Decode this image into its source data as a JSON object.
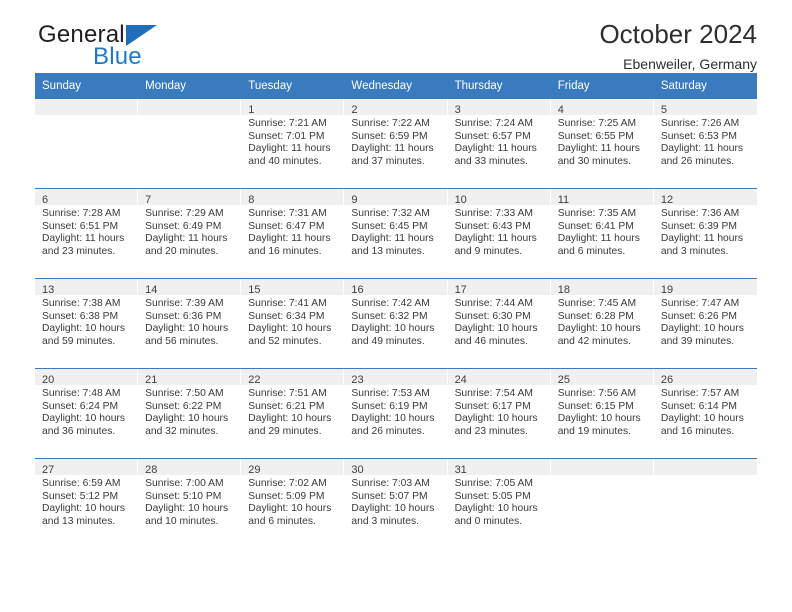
{
  "brand": {
    "name_top": "General",
    "name_bottom": "Blue",
    "triangle_color": "#1f6fba",
    "blue_color": "#1f7ac4"
  },
  "header": {
    "title": "October 2024",
    "subtitle": "Ebenweiler, Germany",
    "header_bg": "#3a7abf",
    "header_text": "#ffffff",
    "daystrip_bg": "#f0f0f0"
  },
  "weekdays": [
    "Sunday",
    "Monday",
    "Tuesday",
    "Wednesday",
    "Thursday",
    "Friday",
    "Saturday"
  ],
  "weeks": [
    [
      {
        "day": "",
        "sunrise": "",
        "sunset": "",
        "daylight": ""
      },
      {
        "day": "",
        "sunrise": "",
        "sunset": "",
        "daylight": ""
      },
      {
        "day": "1",
        "sunrise": "Sunrise: 7:21 AM",
        "sunset": "Sunset: 7:01 PM",
        "daylight": "Daylight: 11 hours and 40 minutes."
      },
      {
        "day": "2",
        "sunrise": "Sunrise: 7:22 AM",
        "sunset": "Sunset: 6:59 PM",
        "daylight": "Daylight: 11 hours and 37 minutes."
      },
      {
        "day": "3",
        "sunrise": "Sunrise: 7:24 AM",
        "sunset": "Sunset: 6:57 PM",
        "daylight": "Daylight: 11 hours and 33 minutes."
      },
      {
        "day": "4",
        "sunrise": "Sunrise: 7:25 AM",
        "sunset": "Sunset: 6:55 PM",
        "daylight": "Daylight: 11 hours and 30 minutes."
      },
      {
        "day": "5",
        "sunrise": "Sunrise: 7:26 AM",
        "sunset": "Sunset: 6:53 PM",
        "daylight": "Daylight: 11 hours and 26 minutes."
      }
    ],
    [
      {
        "day": "6",
        "sunrise": "Sunrise: 7:28 AM",
        "sunset": "Sunset: 6:51 PM",
        "daylight": "Daylight: 11 hours and 23 minutes."
      },
      {
        "day": "7",
        "sunrise": "Sunrise: 7:29 AM",
        "sunset": "Sunset: 6:49 PM",
        "daylight": "Daylight: 11 hours and 20 minutes."
      },
      {
        "day": "8",
        "sunrise": "Sunrise: 7:31 AM",
        "sunset": "Sunset: 6:47 PM",
        "daylight": "Daylight: 11 hours and 16 minutes."
      },
      {
        "day": "9",
        "sunrise": "Sunrise: 7:32 AM",
        "sunset": "Sunset: 6:45 PM",
        "daylight": "Daylight: 11 hours and 13 minutes."
      },
      {
        "day": "10",
        "sunrise": "Sunrise: 7:33 AM",
        "sunset": "Sunset: 6:43 PM",
        "daylight": "Daylight: 11 hours and 9 minutes."
      },
      {
        "day": "11",
        "sunrise": "Sunrise: 7:35 AM",
        "sunset": "Sunset: 6:41 PM",
        "daylight": "Daylight: 11 hours and 6 minutes."
      },
      {
        "day": "12",
        "sunrise": "Sunrise: 7:36 AM",
        "sunset": "Sunset: 6:39 PM",
        "daylight": "Daylight: 11 hours and 3 minutes."
      }
    ],
    [
      {
        "day": "13",
        "sunrise": "Sunrise: 7:38 AM",
        "sunset": "Sunset: 6:38 PM",
        "daylight": "Daylight: 10 hours and 59 minutes."
      },
      {
        "day": "14",
        "sunrise": "Sunrise: 7:39 AM",
        "sunset": "Sunset: 6:36 PM",
        "daylight": "Daylight: 10 hours and 56 minutes."
      },
      {
        "day": "15",
        "sunrise": "Sunrise: 7:41 AM",
        "sunset": "Sunset: 6:34 PM",
        "daylight": "Daylight: 10 hours and 52 minutes."
      },
      {
        "day": "16",
        "sunrise": "Sunrise: 7:42 AM",
        "sunset": "Sunset: 6:32 PM",
        "daylight": "Daylight: 10 hours and 49 minutes."
      },
      {
        "day": "17",
        "sunrise": "Sunrise: 7:44 AM",
        "sunset": "Sunset: 6:30 PM",
        "daylight": "Daylight: 10 hours and 46 minutes."
      },
      {
        "day": "18",
        "sunrise": "Sunrise: 7:45 AM",
        "sunset": "Sunset: 6:28 PM",
        "daylight": "Daylight: 10 hours and 42 minutes."
      },
      {
        "day": "19",
        "sunrise": "Sunrise: 7:47 AM",
        "sunset": "Sunset: 6:26 PM",
        "daylight": "Daylight: 10 hours and 39 minutes."
      }
    ],
    [
      {
        "day": "20",
        "sunrise": "Sunrise: 7:48 AM",
        "sunset": "Sunset: 6:24 PM",
        "daylight": "Daylight: 10 hours and 36 minutes."
      },
      {
        "day": "21",
        "sunrise": "Sunrise: 7:50 AM",
        "sunset": "Sunset: 6:22 PM",
        "daylight": "Daylight: 10 hours and 32 minutes."
      },
      {
        "day": "22",
        "sunrise": "Sunrise: 7:51 AM",
        "sunset": "Sunset: 6:21 PM",
        "daylight": "Daylight: 10 hours and 29 minutes."
      },
      {
        "day": "23",
        "sunrise": "Sunrise: 7:53 AM",
        "sunset": "Sunset: 6:19 PM",
        "daylight": "Daylight: 10 hours and 26 minutes."
      },
      {
        "day": "24",
        "sunrise": "Sunrise: 7:54 AM",
        "sunset": "Sunset: 6:17 PM",
        "daylight": "Daylight: 10 hours and 23 minutes."
      },
      {
        "day": "25",
        "sunrise": "Sunrise: 7:56 AM",
        "sunset": "Sunset: 6:15 PM",
        "daylight": "Daylight: 10 hours and 19 minutes."
      },
      {
        "day": "26",
        "sunrise": "Sunrise: 7:57 AM",
        "sunset": "Sunset: 6:14 PM",
        "daylight": "Daylight: 10 hours and 16 minutes."
      }
    ],
    [
      {
        "day": "27",
        "sunrise": "Sunrise: 6:59 AM",
        "sunset": "Sunset: 5:12 PM",
        "daylight": "Daylight: 10 hours and 13 minutes."
      },
      {
        "day": "28",
        "sunrise": "Sunrise: 7:00 AM",
        "sunset": "Sunset: 5:10 PM",
        "daylight": "Daylight: 10 hours and 10 minutes."
      },
      {
        "day": "29",
        "sunrise": "Sunrise: 7:02 AM",
        "sunset": "Sunset: 5:09 PM",
        "daylight": "Daylight: 10 hours and 6 minutes."
      },
      {
        "day": "30",
        "sunrise": "Sunrise: 7:03 AM",
        "sunset": "Sunset: 5:07 PM",
        "daylight": "Daylight: 10 hours and 3 minutes."
      },
      {
        "day": "31",
        "sunrise": "Sunrise: 7:05 AM",
        "sunset": "Sunset: 5:05 PM",
        "daylight": "Daylight: 10 hours and 0 minutes."
      },
      {
        "day": "",
        "sunrise": "",
        "sunset": "",
        "daylight": ""
      },
      {
        "day": "",
        "sunrise": "",
        "sunset": "",
        "daylight": ""
      }
    ]
  ]
}
